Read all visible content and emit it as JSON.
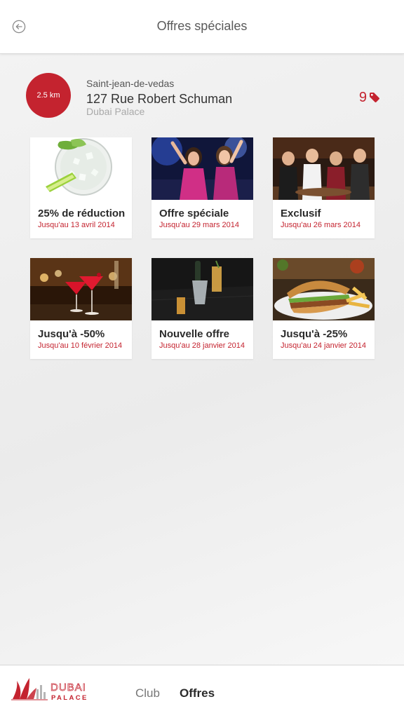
{
  "header": {
    "title": "Offres spéciales",
    "back_icon": "back-arrow-circle-icon"
  },
  "venue": {
    "distance": "2.5 km",
    "city": "Saint-jean-de-vedas",
    "address": "127 Rue Robert Schuman",
    "name": "Dubai Palace",
    "offer_count": "9",
    "offer_icon": "tag-icon"
  },
  "offers": [
    {
      "title": "25% de réduction",
      "date": "Jusqu'au 13 avril 2014",
      "image": "cocktail-glass-lime"
    },
    {
      "title": "Offre spéciale",
      "date": "Jusqu'au 29 mars 2014",
      "image": "party-women-dancing"
    },
    {
      "title": "Exclusif",
      "date": "Jusqu'au 26 mars 2014",
      "image": "friends-celebrating"
    },
    {
      "title": "Jusqu'à -50%",
      "date": "Jusqu'au 10 février 2014",
      "image": "red-cocktails-bar"
    },
    {
      "title": "Nouvelle offre",
      "date": "Jusqu'au 28 janvier 2014",
      "image": "champagne-bucket-lounge"
    },
    {
      "title": "Jusqu'à -25%",
      "date": "Jusqu'au 24 janvier 2014",
      "image": "burger-fries"
    }
  ],
  "bottom_nav": {
    "logo_text_top": "DUBAI",
    "logo_text_bottom": "PALACE",
    "items": [
      "Club",
      "Offres"
    ],
    "active": "Offres"
  },
  "colors": {
    "accent": "#c4232f",
    "text_dark": "#2b2b2b",
    "text_muted": "#a9a9a9"
  }
}
